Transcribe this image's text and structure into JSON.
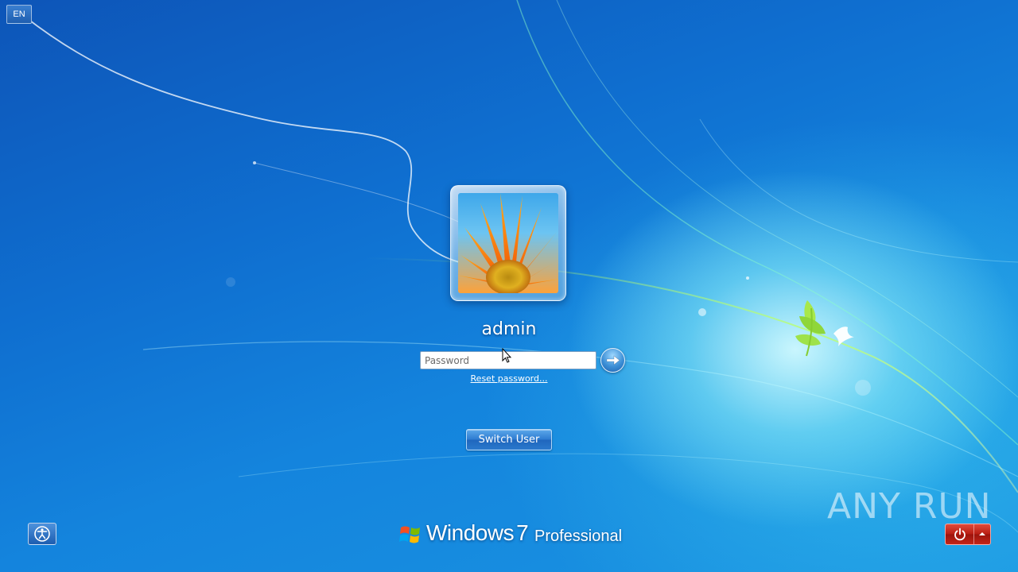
{
  "top_left": {
    "language": "EN"
  },
  "user": {
    "name": "admin"
  },
  "login": {
    "password_placeholder": "Password",
    "reset_link": "Reset password..."
  },
  "actions": {
    "switch_user": "Switch User"
  },
  "branding": {
    "product": "Windows",
    "version": "7",
    "edition": "Professional"
  },
  "watermark": {
    "text": "ANY RUN"
  },
  "icons": {
    "language": "language-indicator",
    "go": "arrow-right-icon",
    "ease_of_access": "ease-of-access-icon",
    "power": "power-icon",
    "power_options": "chevron-up-icon",
    "logo": "windows-logo-icon",
    "avatar": "flower-avatar"
  },
  "colors": {
    "background": "#1484dd",
    "power_button": "#b81c12",
    "text": "#ffffff"
  }
}
